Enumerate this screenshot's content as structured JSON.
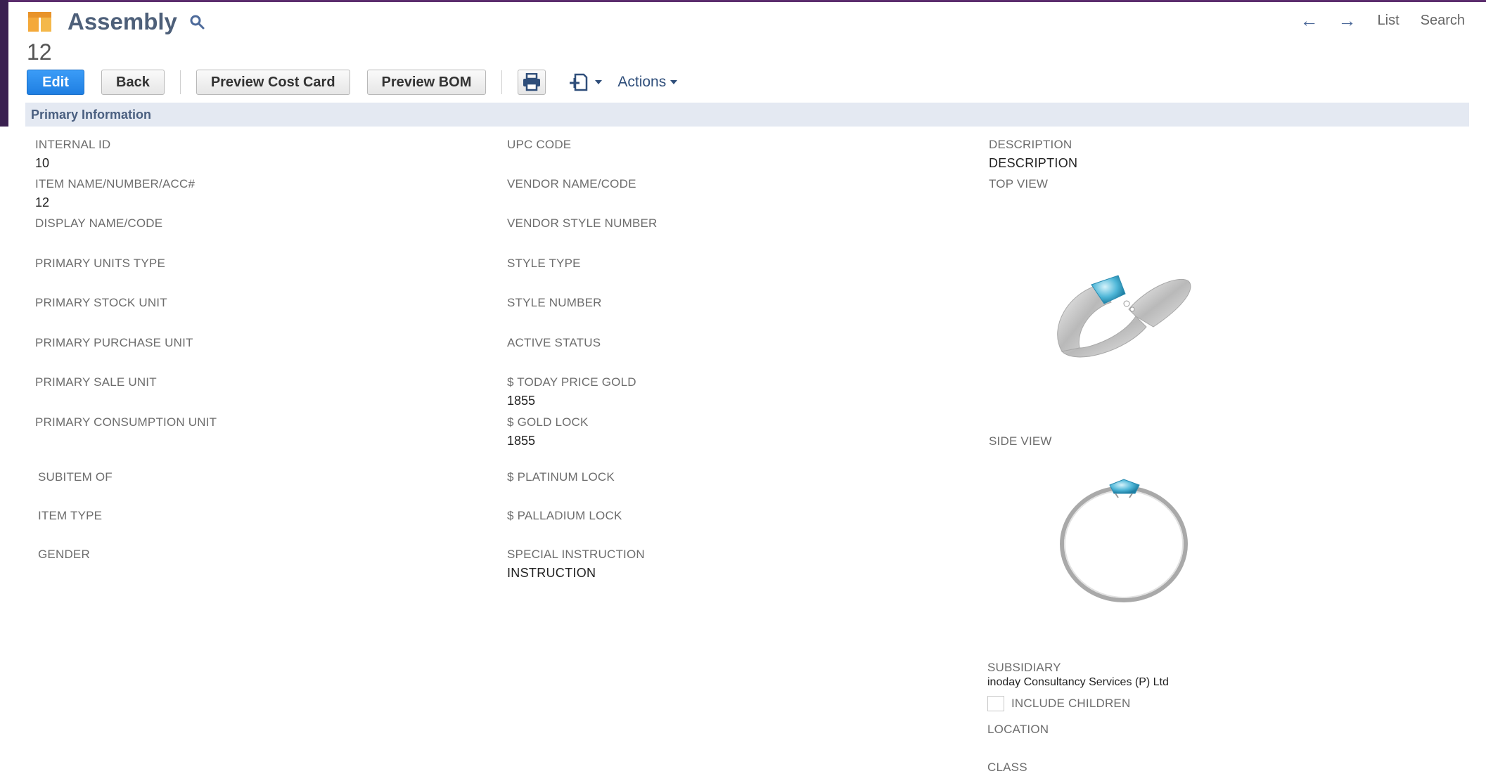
{
  "header": {
    "title": "Assembly",
    "record_number": "12"
  },
  "nav": {
    "list_label": "List",
    "search_label": "Search"
  },
  "toolbar": {
    "edit_label": "Edit",
    "back_label": "Back",
    "preview_cost_card_label": "Preview Cost Card",
    "preview_bom_label": "Preview BOM",
    "actions_label": "Actions"
  },
  "section": {
    "title": "Primary Information"
  },
  "fields": {
    "internal_id": {
      "label": "INTERNAL ID",
      "value": "10"
    },
    "item_name": {
      "label": "ITEM NAME/NUMBER/ACC#",
      "value": "12"
    },
    "display_name": {
      "label": "DISPLAY NAME/CODE",
      "value": ""
    },
    "primary_units_type": {
      "label": "PRIMARY UNITS TYPE",
      "value": ""
    },
    "primary_stock_unit": {
      "label": "PRIMARY STOCK UNIT",
      "value": ""
    },
    "primary_purchase_unit": {
      "label": "PRIMARY PURCHASE UNIT",
      "value": ""
    },
    "primary_sale_unit": {
      "label": "PRIMARY SALE UNIT",
      "value": ""
    },
    "primary_consumption_unit": {
      "label": "PRIMARY CONSUMPTION UNIT",
      "value": ""
    },
    "subitem_of": {
      "label": "SUBITEM OF",
      "value": ""
    },
    "item_type": {
      "label": "ITEM TYPE",
      "value": ""
    },
    "gender": {
      "label": "GENDER",
      "value": ""
    },
    "upc_code": {
      "label": "UPC CODE",
      "value": ""
    },
    "vendor_name": {
      "label": "VENDOR NAME/CODE",
      "value": ""
    },
    "vendor_style_number": {
      "label": "VENDOR STYLE NUMBER",
      "value": ""
    },
    "style_type": {
      "label": "STYLE TYPE",
      "value": ""
    },
    "style_number": {
      "label": "STYLE NUMBER",
      "value": ""
    },
    "active_status": {
      "label": "ACTIVE STATUS",
      "value": ""
    },
    "today_price_gold": {
      "label": "$ TODAY PRICE GOLD",
      "value": "1855"
    },
    "gold_lock": {
      "label": "$ GOLD LOCK",
      "value": "1855"
    },
    "platinum_lock": {
      "label": "$ PLATINUM LOCK",
      "value": ""
    },
    "palladium_lock": {
      "label": "$ PALLADIUM LOCK",
      "value": ""
    },
    "special_instruction": {
      "label": "SPECIAL INSTRUCTION",
      "value": "INSTRUCTION"
    },
    "description": {
      "label": "DESCRIPTION",
      "value": "DESCRIPTION"
    },
    "top_view": {
      "label": "TOP VIEW"
    },
    "side_view": {
      "label": "SIDE VIEW"
    },
    "subsidiary": {
      "label": "SUBSIDIARY",
      "value": "inoday Consultancy Services (P) Ltd"
    },
    "include_children": {
      "label": "INCLUDE CHILDREN",
      "checked": false
    },
    "location": {
      "label": "LOCATION",
      "value": ""
    },
    "class": {
      "label": "CLASS",
      "value": ""
    }
  },
  "colors": {
    "primary_button": "#1f7fe2",
    "section_bar": "#e4e9f2",
    "title": "#4d5f79",
    "gem": "#4fb7d8"
  },
  "icons": [
    "assembly-record-icon",
    "search-icon",
    "back-arrow-icon",
    "forward-arrow-icon",
    "print-icon",
    "new-record-icon",
    "chevron-down-icon"
  ]
}
